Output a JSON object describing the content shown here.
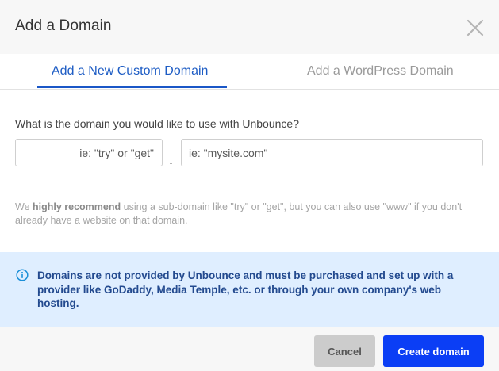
{
  "dialog": {
    "title": "Add a Domain"
  },
  "tabs": [
    {
      "label": "Add a New Custom Domain",
      "active": true
    },
    {
      "label": "Add a WordPress Domain",
      "active": false
    }
  ],
  "form": {
    "question": "What is the domain you would like to use with Unbounce?",
    "subdomain_placeholder": "ie: \"try\" or \"get\"",
    "subdomain_value": "",
    "separator": ".",
    "domain_placeholder": "ie: \"mysite.com\"",
    "domain_value": ""
  },
  "hint": {
    "prefix": "We ",
    "emphasis": "highly recommend",
    "suffix": " using a sub-domain like \"try\" or \"get\", but you can also use \"www\" if you don't already have a website on that domain."
  },
  "info": {
    "text": "Domains are not provided by Unbounce and must be purchased and set up with a provider like GoDaddy, Media Temple, etc. or through your own company's web hosting."
  },
  "footer": {
    "cancel_label": "Cancel",
    "create_label": "Create domain"
  },
  "colors": {
    "accent": "#1a57c7",
    "primary_button": "#0b3ef5",
    "info_background": "#dfeeff",
    "info_text": "#234a8f"
  },
  "icons": {
    "close": "close-icon",
    "info": "info-icon"
  }
}
